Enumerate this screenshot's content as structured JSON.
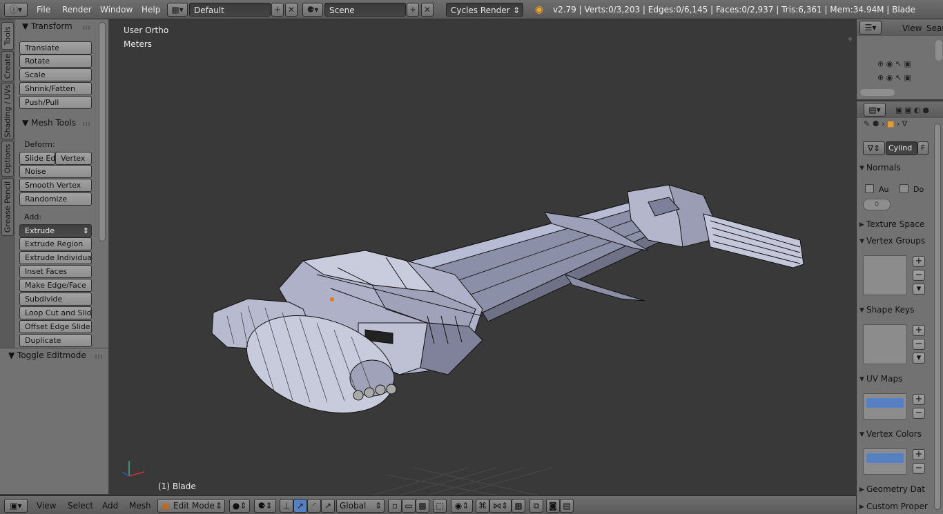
{
  "topbar": {
    "menus": [
      "File",
      "Render",
      "Window",
      "Help"
    ],
    "layout": "Default",
    "scene": "Scene",
    "engine": "Cycles Render",
    "stats": "v2.79 | Verts:0/3,203 | Edges:0/6,145 | Faces:0/2,937 | Tris:6,361 | Mem:34.94M | Blade"
  },
  "tabs": [
    "Tools",
    "Create",
    "Shading / UVs",
    "Options",
    "Grease Pencil"
  ],
  "toolshelf": {
    "transform_title": "Transform",
    "transform_buttons": [
      "Translate",
      "Rotate",
      "Scale",
      "Shrink/Fatten",
      "Push/Pull"
    ],
    "mesh_tools_title": "Mesh Tools",
    "deform_label": "Deform:",
    "slide_edge": "Slide Ed",
    "vertex": "Vertex",
    "deform_buttons": [
      "Noise",
      "Smooth Vertex",
      "Randomize"
    ],
    "add_label": "Add:",
    "extrude": "Extrude",
    "add_buttons": [
      "Extrude Region",
      "Extrude Individual",
      "Inset Faces",
      "Make Edge/Face",
      "Subdivide",
      "Loop Cut and Slide",
      "Offset Edge Slide",
      "Duplicate"
    ],
    "toggle_editmode": "Toggle Editmode"
  },
  "viewport": {
    "view_name": "User Ortho",
    "units": "Meters",
    "object_label": "(1) Blade"
  },
  "bottombar": {
    "menus": [
      "View",
      "Select",
      "Add",
      "Mesh"
    ],
    "mode": "Edit Mode",
    "orientation": "Global"
  },
  "outliner": {
    "view": "View",
    "search": "Searc"
  },
  "properties": {
    "datablock": "Cylind",
    "fake_user": "F",
    "normals": "Normals",
    "auto_smooth": "Au",
    "double_sided": "Do",
    "angle_value": "0",
    "texture_space": "Texture Space",
    "vertex_groups": "Vertex Groups",
    "shape_keys": "Shape Keys",
    "uv_maps": "UV Maps",
    "vertex_colors": "Vertex Colors",
    "geometry_data": "Geometry Dat",
    "custom_props": "Custom Proper"
  }
}
